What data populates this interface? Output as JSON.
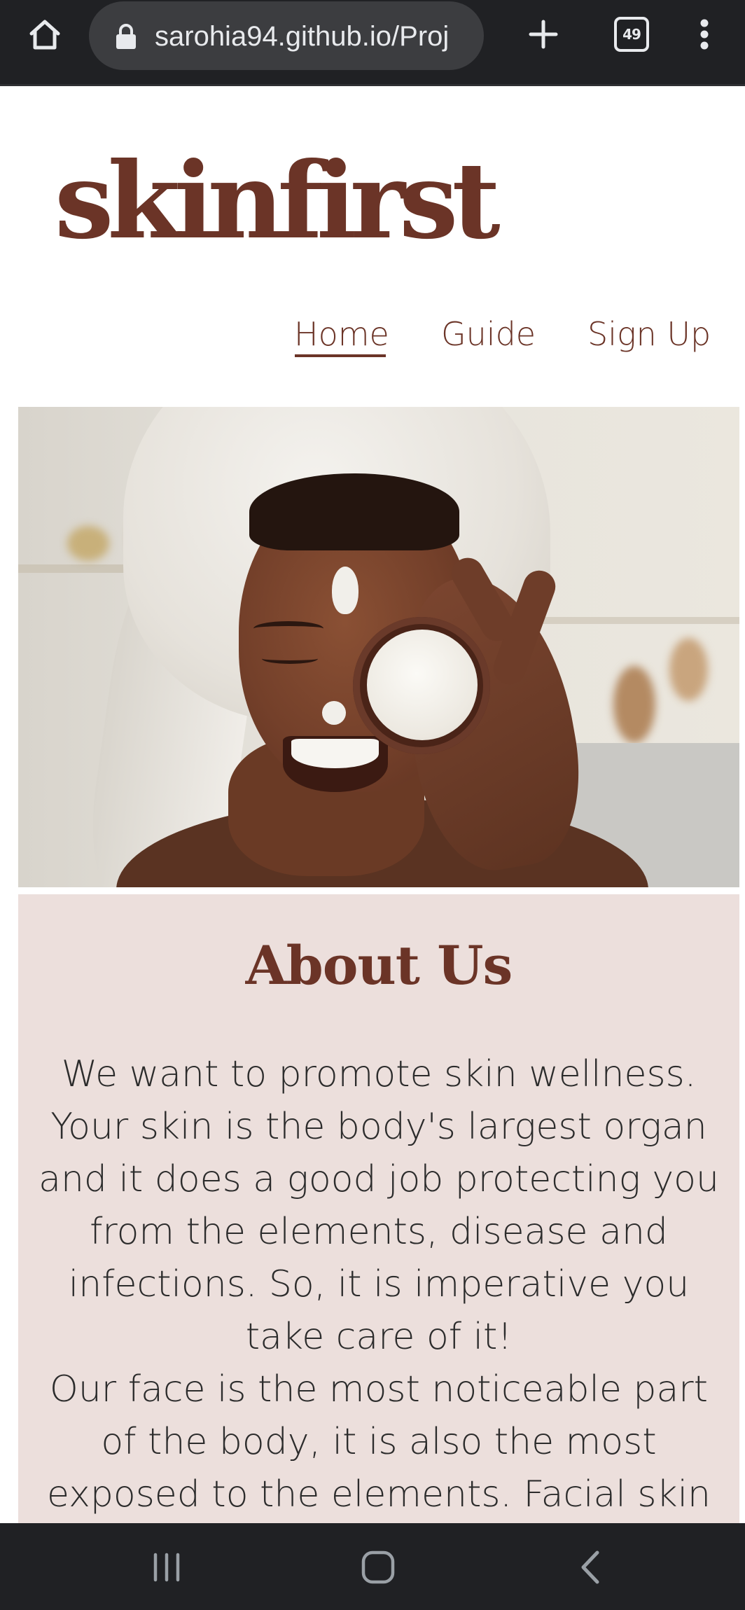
{
  "browser": {
    "url": "sarohia94.github.io/Proj",
    "tab_count": "49",
    "icons": {
      "home": "home-icon",
      "lock": "lock-icon",
      "new_tab": "plus-icon",
      "tabs": "tab-switcher-icon",
      "menu": "more-vert-icon"
    }
  },
  "site": {
    "logo": "skinfirst",
    "nav": {
      "home": "Home",
      "guide": "Guide",
      "signup": "Sign Up",
      "active": "Home"
    },
    "hero": {
      "image": "smiling-woman-with-face-cream-jar-photo"
    },
    "about": {
      "title": "About Us",
      "paragraph1": "We want to promote skin wellness. Your skin is the body's largest organ and it does a good job protecting you from the elements, disease and infections. So, it is imperative you take care of it!",
      "paragraph2": "Our face is the most noticeable part of the body, it is also the most exposed to the elements. Facial skin"
    }
  },
  "system_nav": {
    "icons": [
      "recents-icon",
      "home-icon",
      "back-icon"
    ]
  },
  "colors": {
    "brand_brown": "#6b3427",
    "about_background": "#ecdfdc",
    "chrome_dark": "#202124",
    "url_pill": "#3c3d40"
  }
}
